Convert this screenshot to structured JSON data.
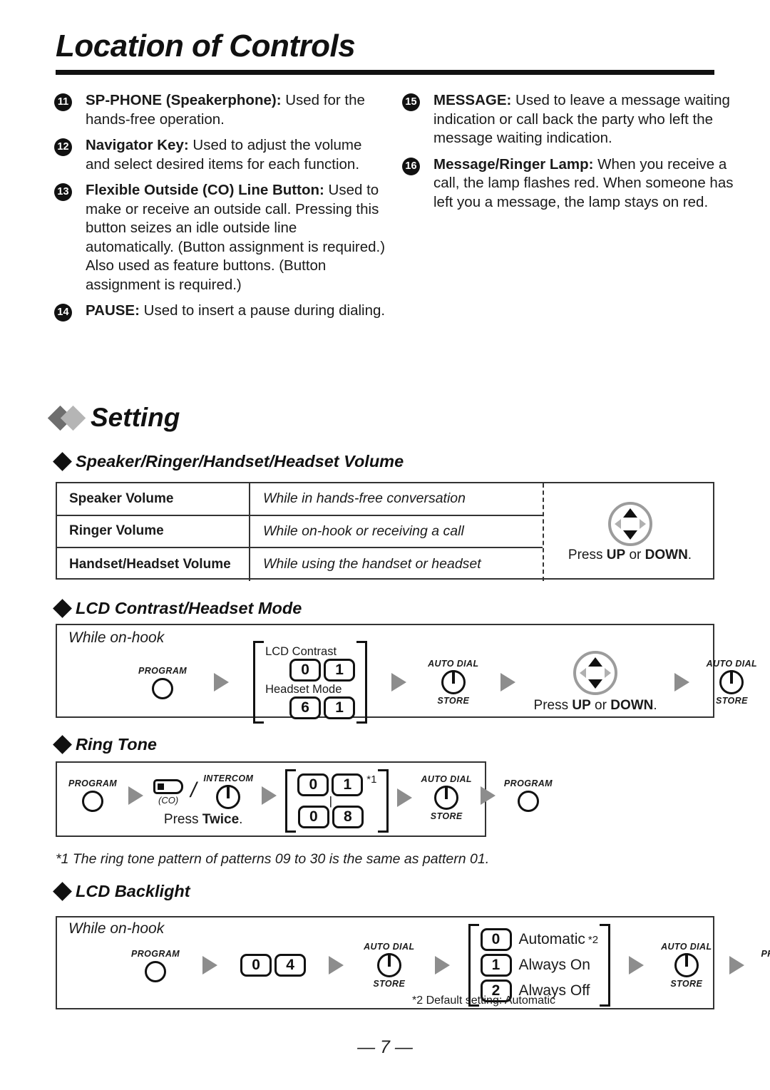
{
  "header": {
    "title": "Location of Controls",
    "page_number": "— 7 —"
  },
  "controls_list": {
    "left": [
      {
        "num": "11",
        "bold": "SP-PHONE (Speakerphone):",
        "text": " Used for the hands-free operation."
      },
      {
        "num": "12",
        "bold": "Navigator Key:",
        "text": " Used to adjust the volume and select desired items for each function."
      },
      {
        "num": "13",
        "bold": "Flexible Outside (CO) Line Button:",
        "text": " Used to make or receive an outside call. Pressing this button seizes an idle outside line automatically. (Button assignment is required.) Also used as feature buttons. (Button assignment is required.)"
      },
      {
        "num": "14",
        "bold": "PAUSE:",
        "text": " Used to insert a pause during dialing."
      }
    ],
    "right": [
      {
        "num": "15",
        "bold": "MESSAGE:",
        "text": " Used to leave a message waiting indication or call back the party who left the message waiting indication."
      },
      {
        "num": "16",
        "bold": "Message/Ringer Lamp:",
        "text": " When you receive a call, the lamp flashes red. When someone has left you a message, the lamp stays on red."
      }
    ]
  },
  "setting": {
    "heading": "Setting",
    "sections": {
      "volume": {
        "heading": "Speaker/Ringer/Handset/Headset Volume",
        "rows": [
          {
            "name": "Speaker Volume",
            "condition": "While in hands-free conversation"
          },
          {
            "name": "Ringer Volume",
            "condition": "While on-hook or receiving a call"
          },
          {
            "name": "Handset/Headset Volume",
            "condition": "While using the handset or headset"
          }
        ],
        "press_prefix": "Press ",
        "press_up": "UP",
        "press_or": " or ",
        "press_down": "DOWN",
        "press_suffix": "."
      },
      "lcd_contrast": {
        "heading": "LCD Contrast/Headset Mode",
        "while": "While on-hook",
        "program_label": "PROGRAM",
        "contrast_label": "LCD Contrast",
        "contrast_keys": [
          "0",
          "1"
        ],
        "headset_label": "Headset Mode",
        "headset_keys": [
          "6",
          "1"
        ],
        "store_top": "AUTO DIAL",
        "store_bottom": "STORE",
        "press_prefix": "Press ",
        "press_up": "UP",
        "press_or": " or ",
        "press_down": "DOWN",
        "press_suffix": "."
      },
      "ring_tone": {
        "heading": "Ring Tone",
        "program_label": "PROGRAM",
        "co_label": "(CO)",
        "slash": "/",
        "intercom_label": "INTERCOM",
        "press_prefix": "Press ",
        "press_bold": "Twice",
        "press_suffix": ".",
        "range_top": [
          "0",
          "1"
        ],
        "range_top_note": "*1",
        "range_separator": "|",
        "range_bottom": [
          "0",
          "8"
        ],
        "store_top": "AUTO DIAL",
        "store_bottom": "STORE",
        "footnote": "*1  The ring tone pattern of patterns 09 to 30 is the same as pattern 01."
      },
      "lcd_backlight": {
        "heading": "LCD Backlight",
        "while": "While on-hook",
        "program_label": "PROGRAM",
        "keys": [
          "0",
          "4"
        ],
        "store_top": "AUTO DIAL",
        "store_bottom": "STORE",
        "options": [
          {
            "key": "0",
            "label": "Automatic",
            "note": "*2"
          },
          {
            "key": "1",
            "label": "Always On",
            "note": ""
          },
          {
            "key": "2",
            "label": "Always Off",
            "note": ""
          }
        ],
        "footnote": "*2  Default setting: Automatic"
      }
    }
  }
}
